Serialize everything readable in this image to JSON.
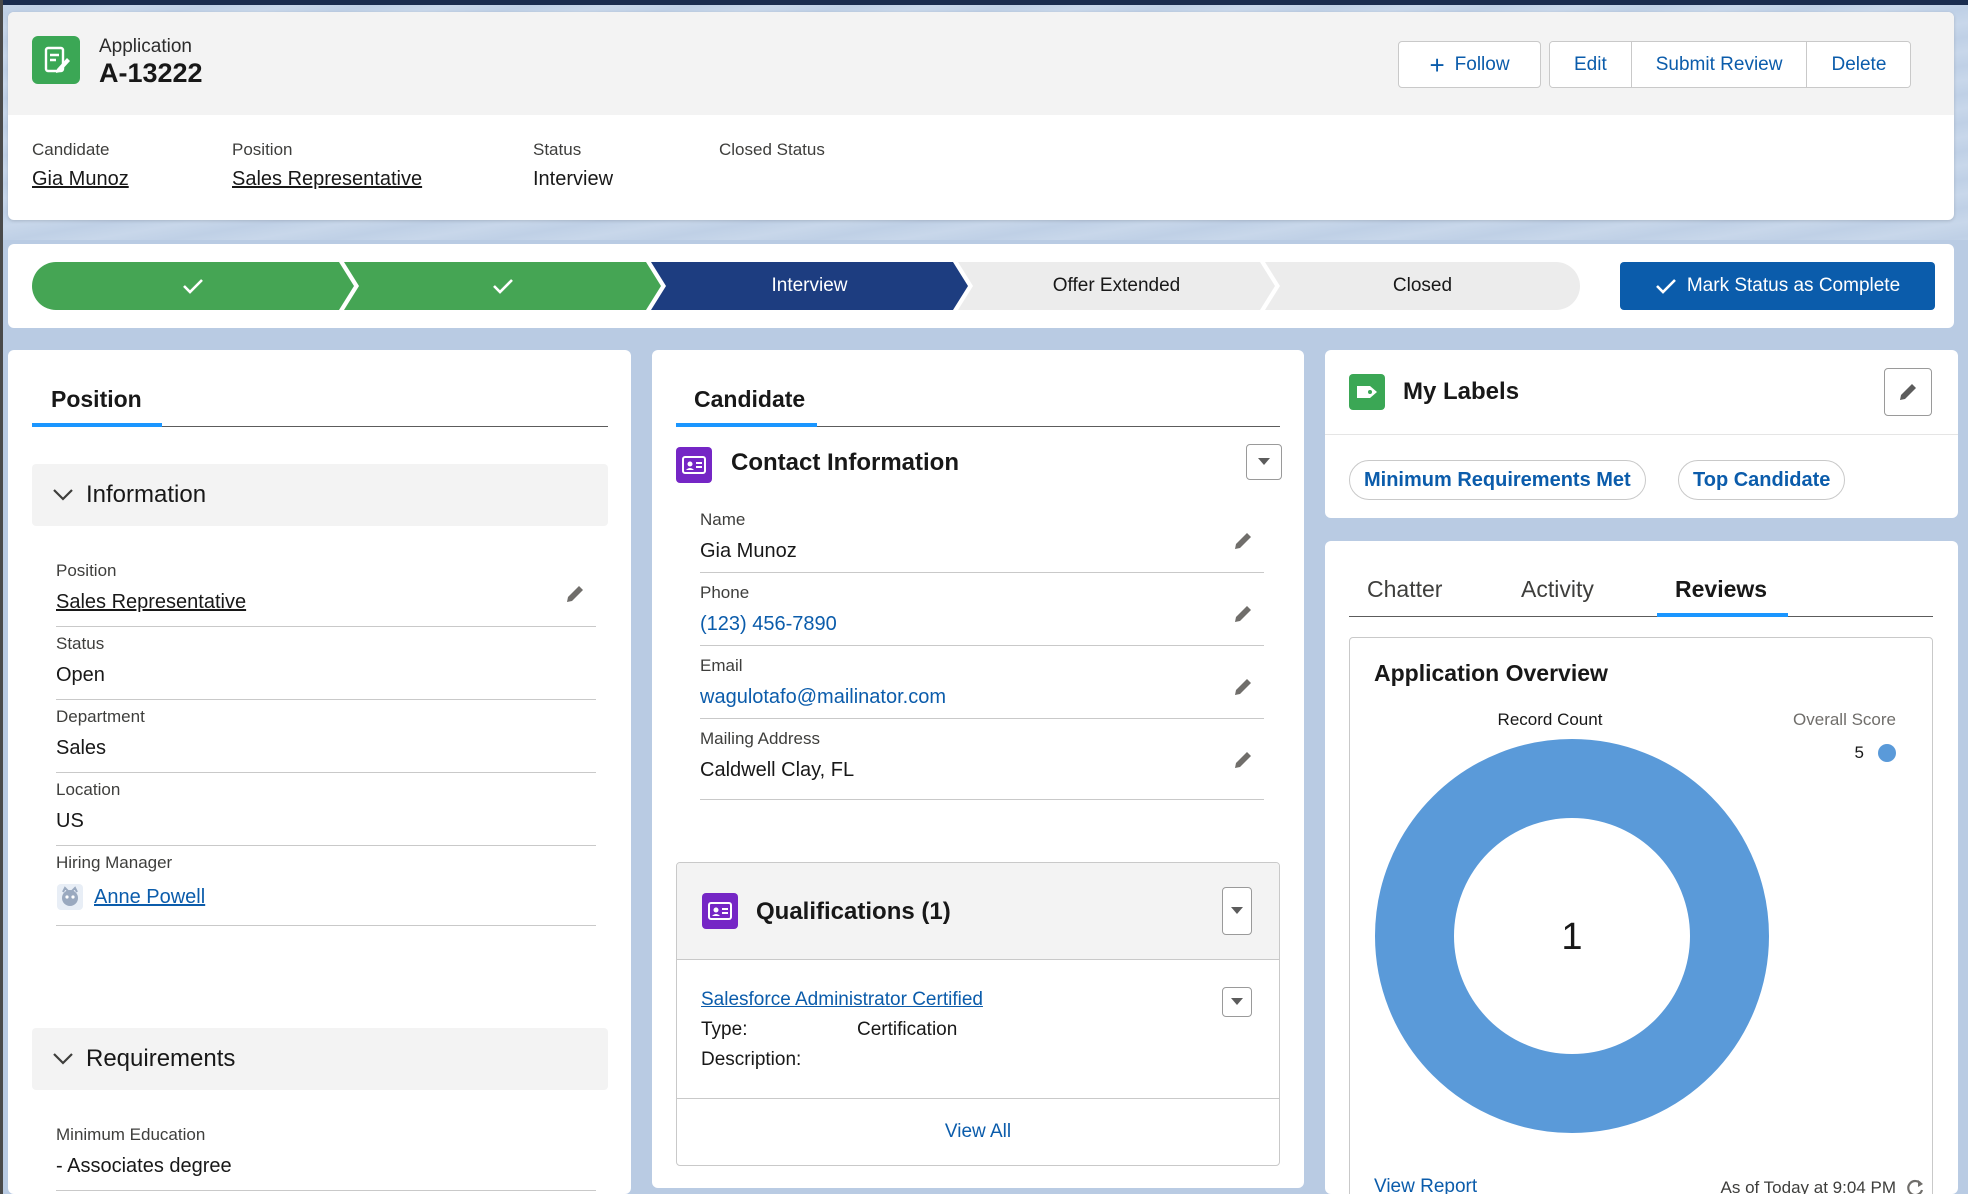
{
  "header": {
    "record_type": "Application",
    "record_name": "A-13222",
    "buttons": {
      "follow": "Follow",
      "edit": "Edit",
      "submit_review": "Submit Review",
      "delete": "Delete"
    },
    "fields": [
      {
        "label": "Candidate",
        "value": "Gia Munoz"
      },
      {
        "label": "Position",
        "value": "Sales Representative"
      },
      {
        "label": "Status",
        "value": "Interview"
      },
      {
        "label": "Closed Status",
        "value": ""
      }
    ]
  },
  "path": {
    "stages": [
      {
        "label": "",
        "state": "complete"
      },
      {
        "label": "",
        "state": "complete"
      },
      {
        "label": "Interview",
        "state": "current"
      },
      {
        "label": "Offer Extended",
        "state": "incomplete"
      },
      {
        "label": "Closed",
        "state": "incomplete"
      }
    ],
    "mark_complete_label": "Mark Status as Complete"
  },
  "position_panel": {
    "tab": "Position",
    "information": {
      "title": "Information",
      "fields": [
        {
          "label": "Position",
          "value": "Sales Representative"
        },
        {
          "label": "Status",
          "value": "Open"
        },
        {
          "label": "Department",
          "value": "Sales"
        },
        {
          "label": "Location",
          "value": "US"
        },
        {
          "label": "Hiring Manager",
          "value": "Anne Powell"
        }
      ]
    },
    "requirements": {
      "title": "Requirements",
      "fields": [
        {
          "label": "Minimum Education",
          "value": "- Associates degree"
        }
      ]
    }
  },
  "candidate_panel": {
    "tab": "Candidate",
    "contact": {
      "title": "Contact Information",
      "fields": [
        {
          "label": "Name",
          "value": "Gia Munoz"
        },
        {
          "label": "Phone",
          "value": "(123) 456-7890"
        },
        {
          "label": "Email",
          "value": "wagulotafo@mailinator.com"
        },
        {
          "label": "Mailing Address",
          "value": "Caldwell Clay, FL"
        }
      ]
    },
    "qualifications": {
      "title": "Qualifications (1)",
      "item": {
        "name": "Salesforce Administrator Certified",
        "type_label": "Type:",
        "type_value": "Certification",
        "description_label": "Description:"
      },
      "view_all": "View All"
    }
  },
  "labels_panel": {
    "title": "My Labels",
    "labels": [
      "Minimum Requirements Met",
      "Top Candidate"
    ]
  },
  "activity_panel": {
    "tabs": [
      "Chatter",
      "Activity",
      "Reviews"
    ],
    "active_tab": "Reviews",
    "overview_title": "Application Overview",
    "view_report": "View Report",
    "as_of": "As of Today at 9:04 PM"
  },
  "chart_data": {
    "type": "pie",
    "title": "Record Count",
    "legend_title": "Overall Score",
    "legend_placement": "top-right",
    "center_label": "1",
    "categories": [
      "5"
    ],
    "values": [
      1
    ],
    "colors": [
      "#5a9ad9"
    ]
  },
  "colors": {
    "brand_blue": "#0b5cab",
    "path_complete": "#45a554",
    "path_current": "#1d3d80",
    "path_incomplete": "#ececec",
    "record_icon": "#3ba755",
    "card_icon": "#7526c5",
    "donut": "#5a9ad9"
  }
}
